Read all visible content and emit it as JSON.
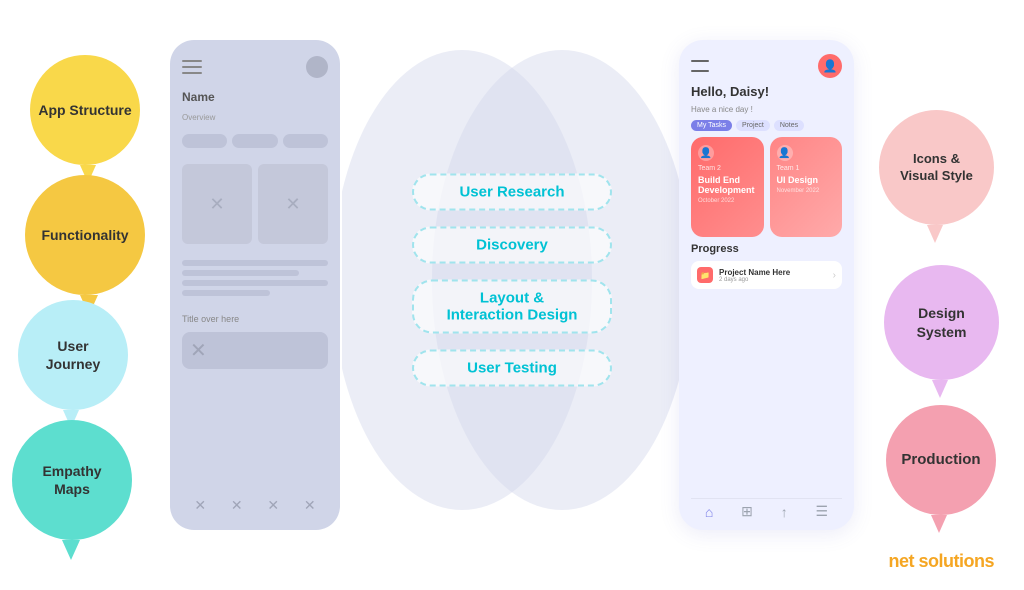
{
  "bubbles": {
    "app_structure": "App\nStructure",
    "functionality": "Functionality",
    "user_journey": "User\nJourney",
    "empathy_maps": "Empathy\nMaps",
    "icons_visual": "Icons &\nVisual Style",
    "design_system": "Design\nSystem",
    "production": "Production"
  },
  "center_labels": {
    "user_research": "User Research",
    "discovery": "Discovery",
    "layout_interaction": "Layout &\nInteraction Design",
    "user_testing": "User Testing"
  },
  "app": {
    "greeting": "Hello, Daisy!",
    "subtext": "Have a nice day !",
    "tabs": [
      "My Tasks",
      "Project",
      "Notes"
    ],
    "task1_title": "Team 2",
    "task1_name": "Build End\nDevelopment",
    "task1_date": "October 2022",
    "task2_title": "Team 1",
    "task2_name": "UI Design",
    "task2_date": "November 2022",
    "progress_label": "Progress",
    "project_name": "Project Name Here",
    "project_sub": "2 days ago"
  },
  "logo": {
    "brand": "net solutions"
  }
}
